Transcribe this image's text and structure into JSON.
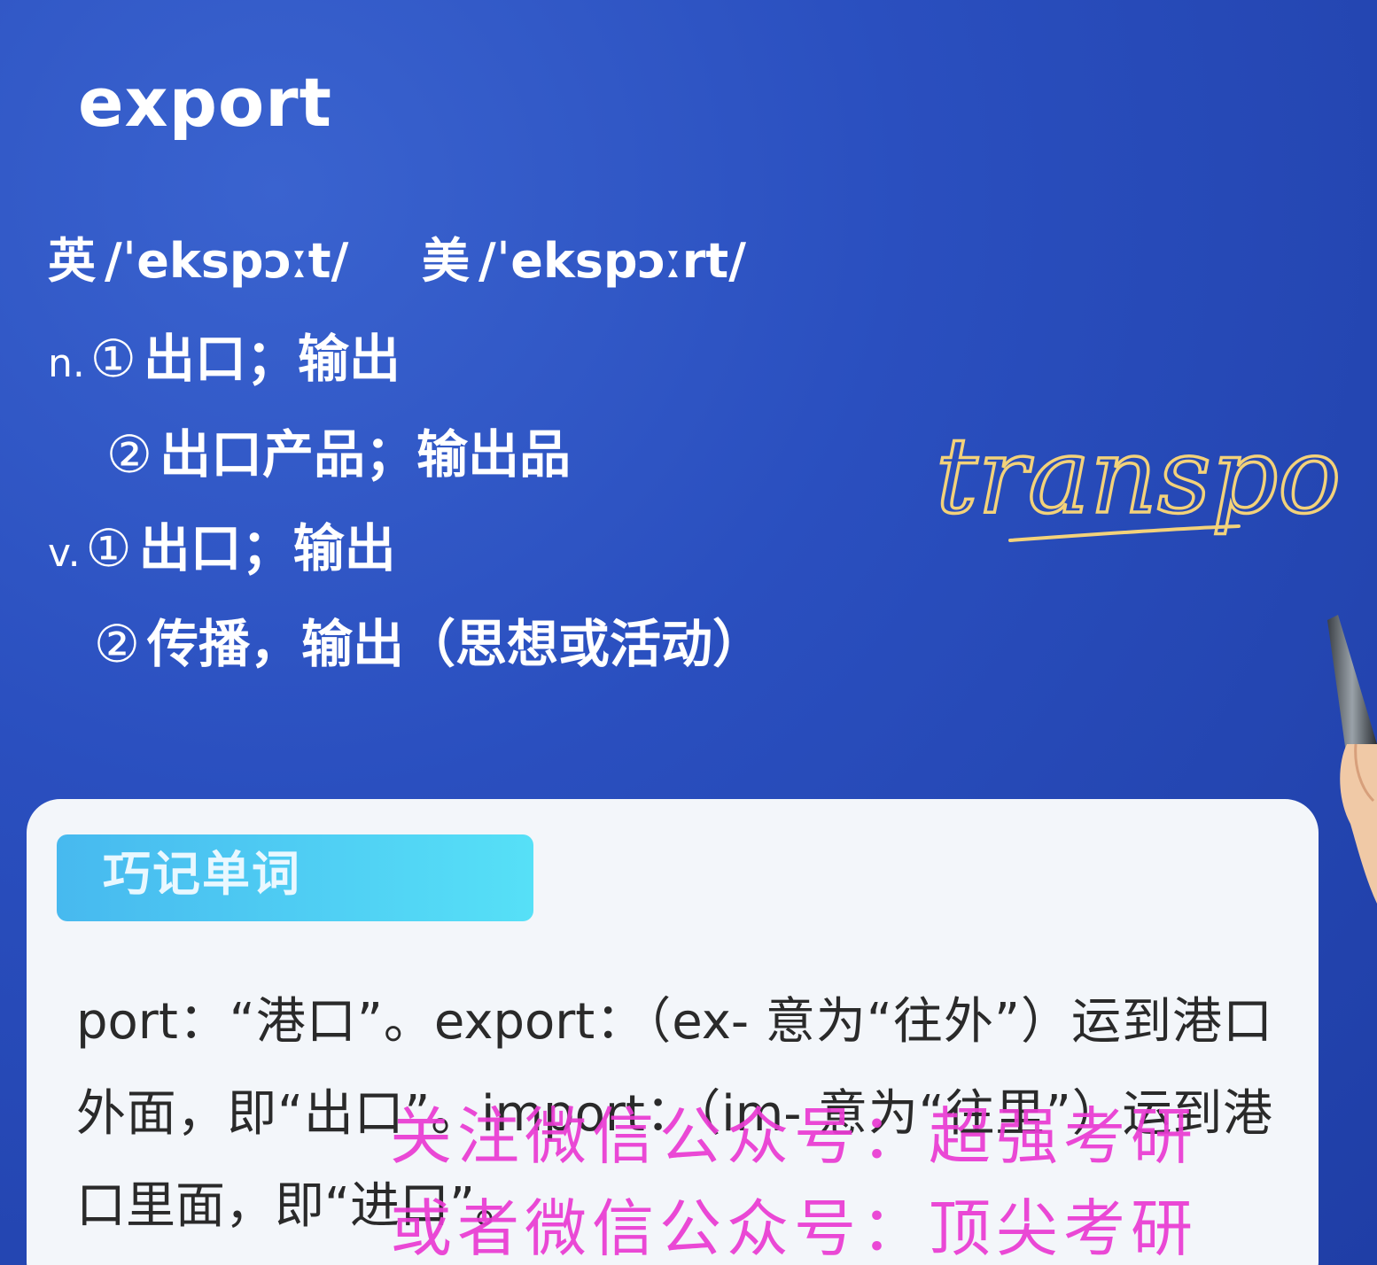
{
  "word": "export",
  "phonetics": {
    "uk_tag": "英",
    "uk": "/ˈekspɔːt/",
    "us_tag": "美",
    "us": "/ˈekspɔːrt/"
  },
  "definitions": [
    {
      "pos": "n.",
      "num": "①",
      "text": "出口；输出"
    },
    {
      "pos": "",
      "num": "②",
      "text": "出口产品；输出品"
    },
    {
      "pos": "v.",
      "num": "①",
      "text": "出口；输出"
    },
    {
      "pos": "",
      "num": "②",
      "text": "传播，输出（思想或活动）"
    }
  ],
  "handwriting": "transpo",
  "memo": {
    "label": "巧记单词",
    "text": "port：“港口”。export：（ex- 意为“往外”）运到港口外面，即“出口”。import：（im- 意为“往里”）运到港口里面，即“进口”。"
  },
  "watermarks": [
    "关注微信公众号：超强考研",
    "或者微信公众号：顶尖考研"
  ],
  "colors": {
    "background": "#2a4fbf",
    "handwriting": "#f3d27a",
    "tab_gradient_start": "#47b9ef",
    "tab_gradient_end": "#56e0f7",
    "watermark": "#ea3bd3"
  }
}
